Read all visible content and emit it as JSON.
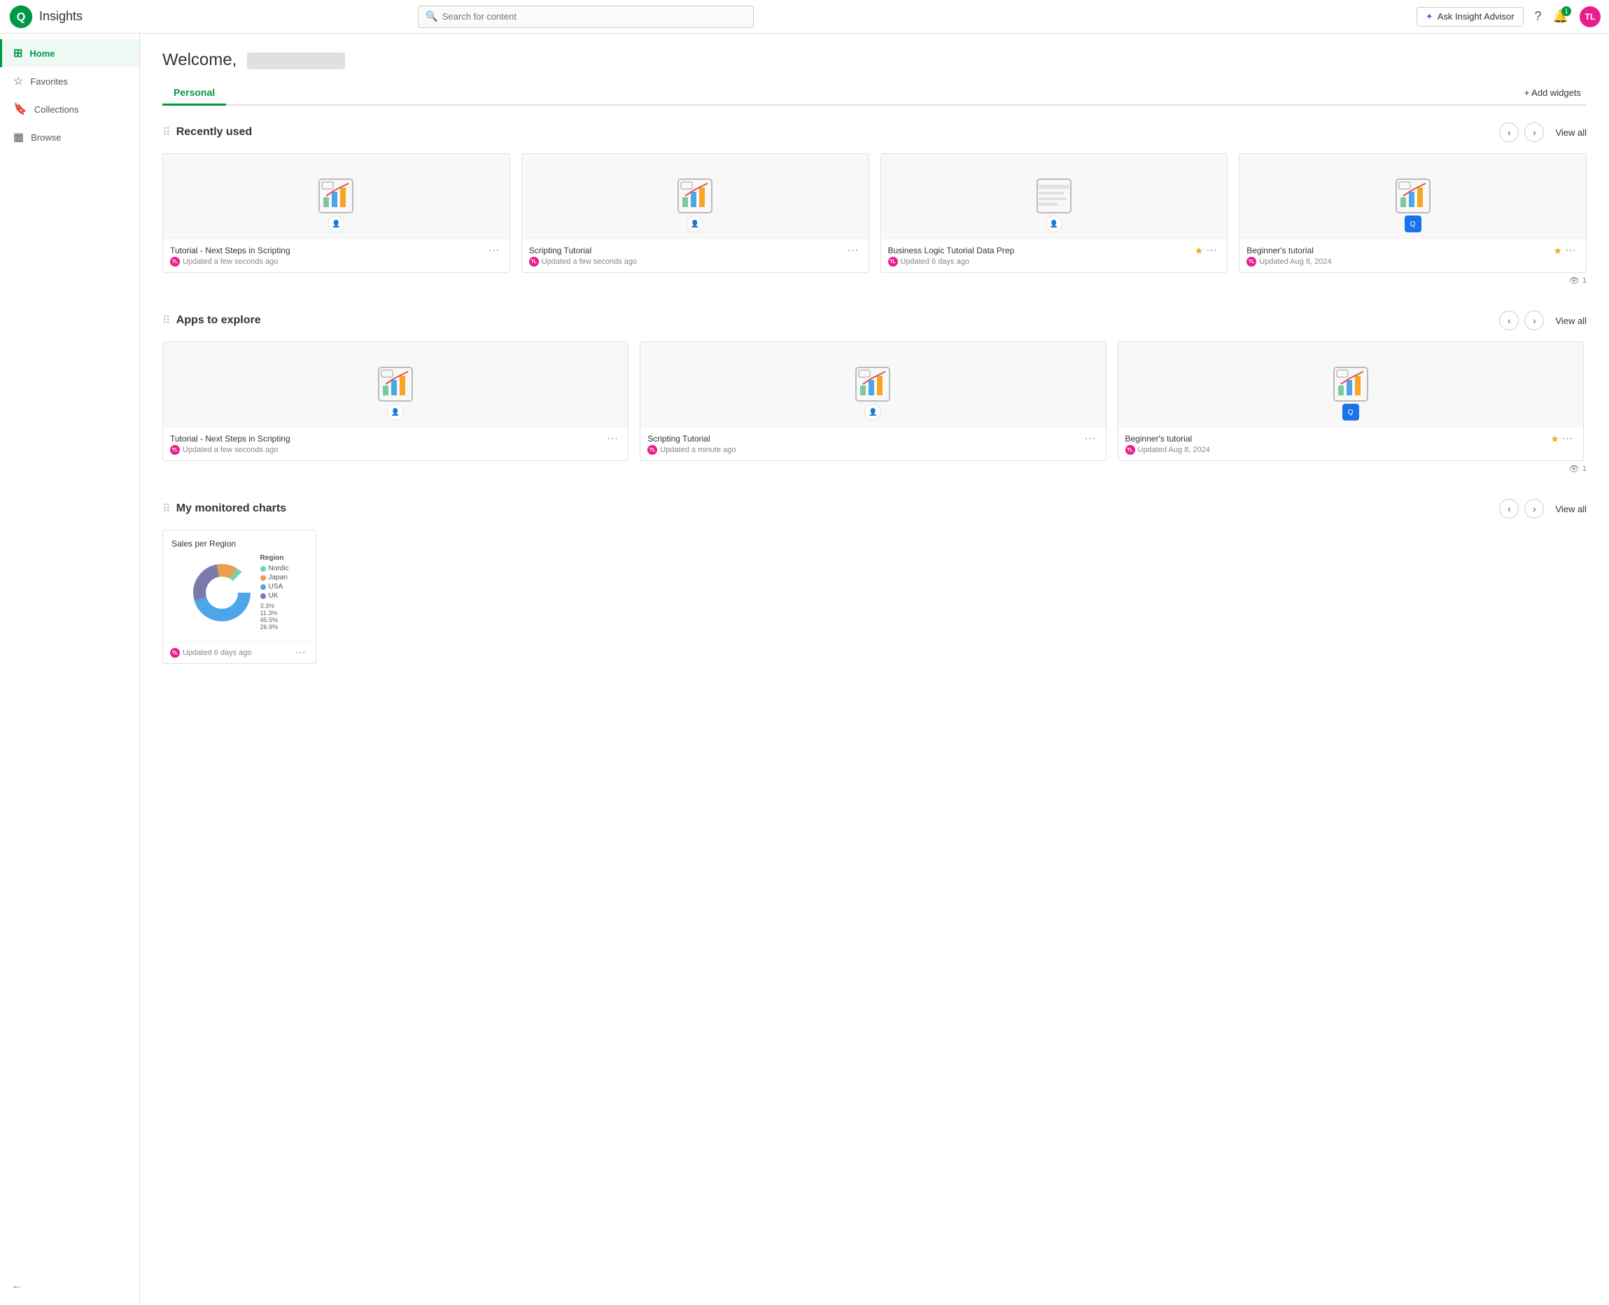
{
  "app": {
    "title": "Insights"
  },
  "topnav": {
    "search_placeholder": "Search for content",
    "ask_advisor_label": "Ask Insight Advisor",
    "help_label": "Help",
    "notifications_count": "1",
    "avatar_initials": "TL"
  },
  "sidebar": {
    "items": [
      {
        "id": "home",
        "label": "Home",
        "icon": "⊞",
        "active": true
      },
      {
        "id": "favorites",
        "label": "Favorites",
        "icon": "☆",
        "active": false
      },
      {
        "id": "collections",
        "label": "Collections",
        "icon": "🔖",
        "active": false
      },
      {
        "id": "browse",
        "label": "Browse",
        "icon": "▦",
        "active": false
      }
    ],
    "collapse_label": "←"
  },
  "main": {
    "welcome_prefix": "Welcome,",
    "tabs": [
      {
        "id": "personal",
        "label": "Personal",
        "active": true
      }
    ],
    "add_widgets_label": "+ Add widgets",
    "sections": {
      "recently_used": {
        "title": "Recently used",
        "view_all": "View all",
        "views_count": "1",
        "cards": [
          {
            "id": "card-1",
            "title": "Tutorial - Next Steps in Scripting",
            "updated": "Updated a few seconds ago",
            "starred": false,
            "owner_type": "user"
          },
          {
            "id": "card-2",
            "title": "Scripting Tutorial",
            "updated": "Updated a few seconds ago",
            "starred": false,
            "owner_type": "user"
          },
          {
            "id": "card-3",
            "title": "Business Logic Tutorial Data Prep",
            "updated": "Updated 6 days ago",
            "starred": true,
            "owner_type": "user"
          },
          {
            "id": "card-4",
            "title": "Beginner's tutorial",
            "updated": "Updated Aug 8, 2024",
            "starred": true,
            "owner_type": "blue"
          }
        ]
      },
      "apps_to_explore": {
        "title": "Apps to explore",
        "view_all": "View all",
        "views_count": "1",
        "cards": [
          {
            "id": "app-card-1",
            "title": "Tutorial - Next Steps in Scripting",
            "updated": "Updated a few seconds ago",
            "starred": false,
            "owner_type": "user"
          },
          {
            "id": "app-card-2",
            "title": "Scripting Tutorial",
            "updated": "Updated a minute ago",
            "starred": false,
            "owner_type": "user"
          },
          {
            "id": "app-card-3",
            "title": "Beginner's tutorial",
            "updated": "Updated Aug 8, 2024",
            "starred": true,
            "owner_type": "blue"
          }
        ]
      },
      "my_monitored_charts": {
        "title": "My monitored charts",
        "view_all": "View all",
        "chart": {
          "title": "Sales per Region",
          "updated": "Updated 6 days ago",
          "legend_label": "Region",
          "segments": [
            {
              "label": "USA",
              "color": "#4da6e8",
              "value": "45.5%"
            },
            {
              "label": "Nordic",
              "color": "#6dd6b0",
              "value": "3.3%"
            },
            {
              "label": "Japan",
              "color": "#e8a04d",
              "value": "11.3%"
            },
            {
              "label": "UK",
              "color": "#7a7aad",
              "value": "26.9%"
            }
          ]
        }
      }
    }
  }
}
